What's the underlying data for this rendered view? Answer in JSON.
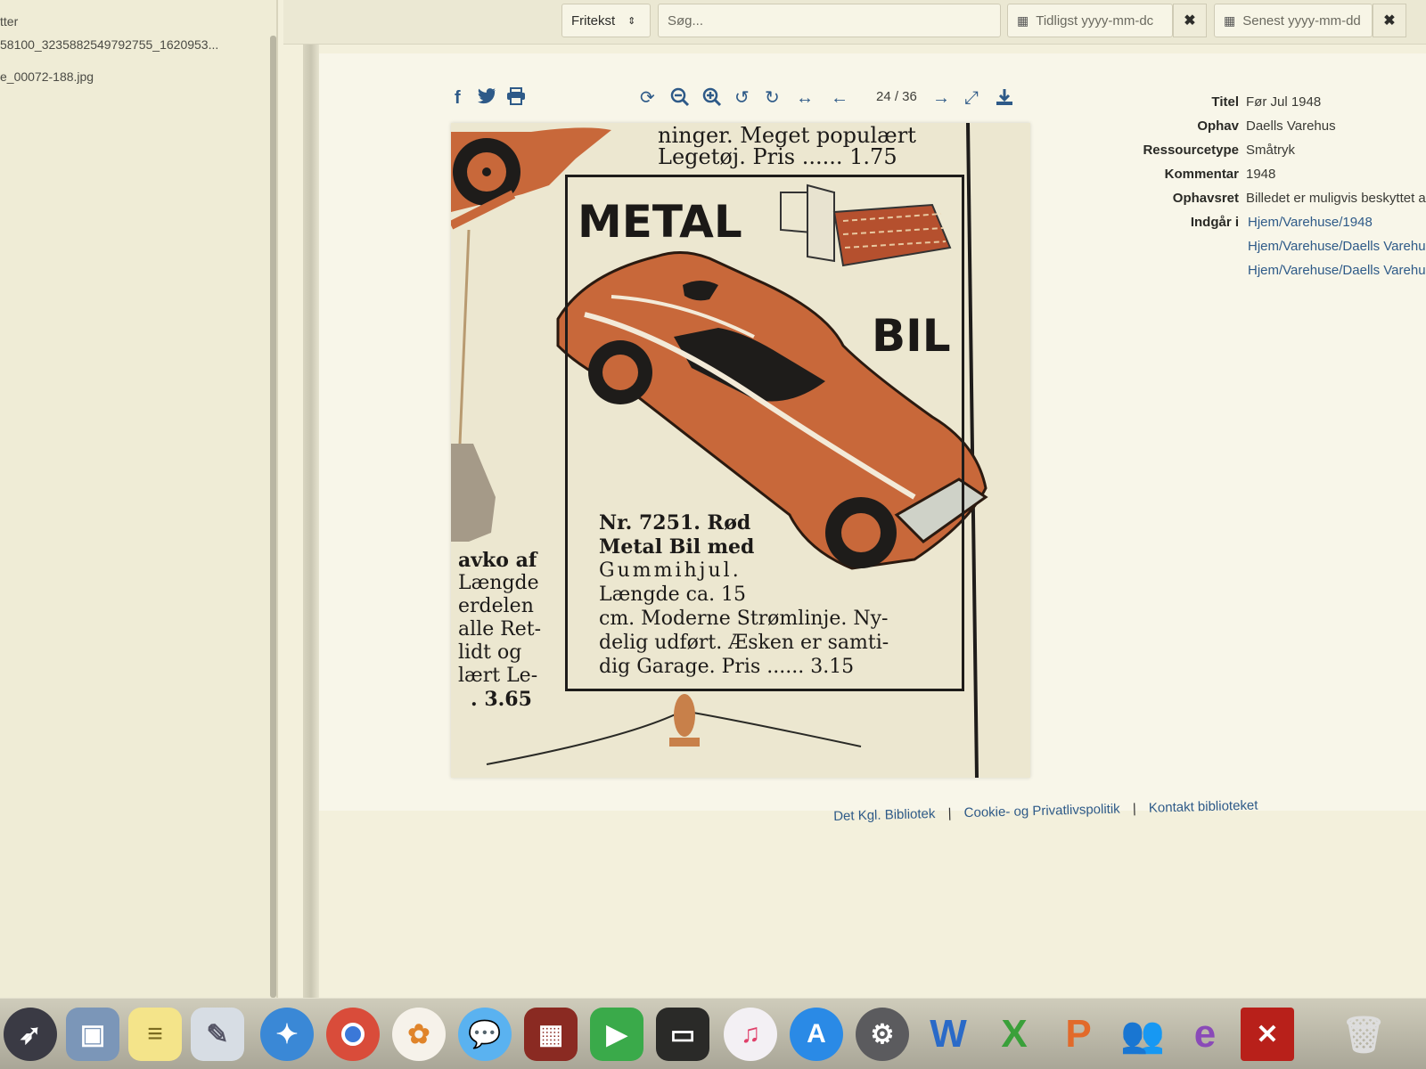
{
  "sidebar": {
    "lines": [
      "tter",
      "58100_3235882549792755_1620953...",
      "e_00072-188.jpg"
    ]
  },
  "search": {
    "type_select": "Fritekst",
    "placeholder": "Søg...",
    "date_from_placeholder": "Tidligst yyyy-mm-dc",
    "date_to_placeholder": "Senest yyyy-mm-dd",
    "clear_glyph": "✖"
  },
  "viewer": {
    "page_counter": "24 / 36",
    "share_icons": [
      "facebook-icon",
      "twitter-icon",
      "print-icon"
    ],
    "tool_icons": [
      "refresh-icon",
      "zoom-out-icon",
      "zoom-in-icon",
      "rotate-left-icon",
      "rotate-right-icon",
      "fit-width-icon",
      "previous-icon",
      "next-icon",
      "fullscreen-icon",
      "download-icon"
    ]
  },
  "scan": {
    "top_line1": "ninger. Meget populært",
    "top_line2": "Legetøj. Pris ...... 1.75",
    "metal": "METAL",
    "bil": "BIL",
    "desc_line1": "Nr. 7251. Rød",
    "desc_line2": "Metal Bil med",
    "desc_line3": "Gummihjul.",
    "desc_line4": "Længde ca. 15",
    "desc_line5": "cm. Moderne Strømlinje. Ny-",
    "desc_line6": "delig udført. Æsken er samti-",
    "desc_line7": "dig Garage. Pris ...... 3.15",
    "side_line1": "avko af",
    "side_line2": "Længde",
    "side_line3": "erdelen",
    "side_line4": "alle Ret-",
    "side_line5": "lidt og",
    "side_line6": "lært Le-",
    "side_line7": ". 3.65"
  },
  "metadata": {
    "titel_label": "Titel",
    "titel_value": "Før Jul 1948",
    "ophav_label": "Ophav",
    "ophav_value": "Daells Varehus",
    "ressource_label": "Ressourcetype",
    "ressource_value": "Småtryk",
    "kommentar_label": "Kommentar",
    "kommentar_value": "1948",
    "ophavsret_label": "Ophavsret",
    "ophavsret_value": "Billedet er muligvis beskyttet a",
    "indgaar_label": "Indgår i",
    "links": [
      "Hjem/Varehuse/1948",
      "Hjem/Varehuse/Daells Varehus",
      "Hjem/Varehuse/Daells Varehus"
    ]
  },
  "footer": {
    "link1": "Det Kgl. Bibliotek",
    "link2": "Cookie- og Privatlivspolitik",
    "link3": "Kontakt biblioteket",
    "separator": "|"
  },
  "dock": {
    "apps": [
      "launchpad-icon",
      "preview-icon",
      "notes-icon",
      "script-editor-icon",
      "safari-icon",
      "chrome-icon",
      "photos-icon",
      "messages-icon",
      "photo-booth-icon",
      "facetime-icon",
      "printer-icon",
      "itunes-icon",
      "app-store-icon",
      "system-preferences-icon",
      "word-icon",
      "excel-icon",
      "powerpoint-icon",
      "messenger-icon",
      "entourage-icon",
      "acrobat-icon",
      "trash-icon"
    ]
  },
  "colors": {
    "link": "#2e5a88",
    "car": "#c8683a",
    "paper": "#ece7d0"
  }
}
